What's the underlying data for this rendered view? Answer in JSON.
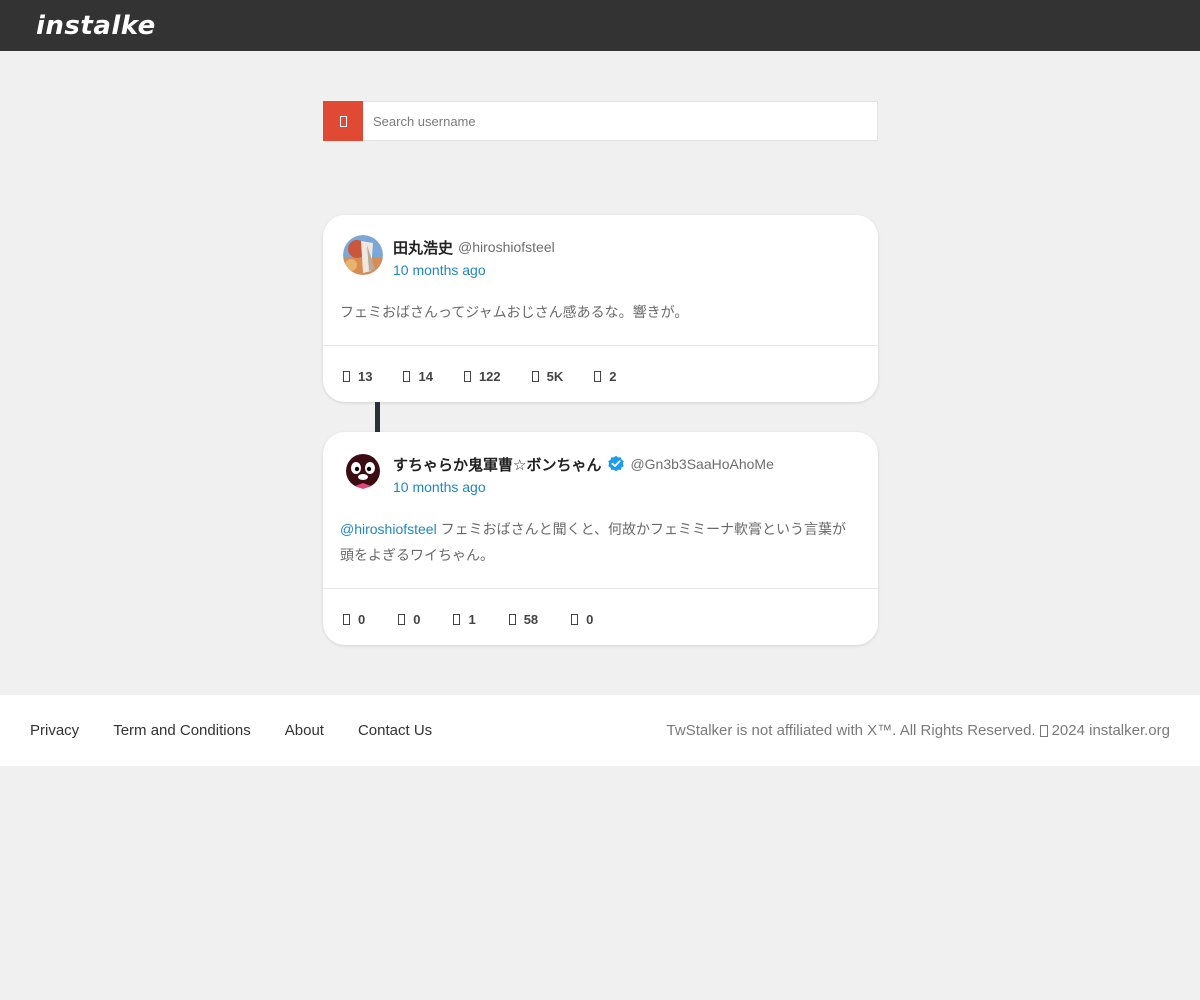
{
  "header": {
    "logo_text": "instalker",
    "logo_color": "#f2704e"
  },
  "search": {
    "placeholder": "Search username",
    "button_color": "#e04a35",
    "button_icon": "search-icon"
  },
  "tweets": [
    {
      "display_name": "田丸浩史",
      "handle": "@hiroshiofsteel",
      "time": "10 months ago",
      "verified": false,
      "mention": "",
      "text": "フェミおばさんってジャムおじさん感あるな。響きが。",
      "stats": {
        "replies": "13",
        "retweets": "14",
        "likes": "122",
        "views": "5K",
        "bookmarks": "2"
      }
    },
    {
      "display_name": "すちゃらか鬼軍曹☆ボンちゃん",
      "handle": "@Gn3b3SaaHoAhoMe",
      "time": "10 months ago",
      "verified": true,
      "mention": "@hiroshiofsteel",
      "text": " フェミおばさんと聞くと、何故かフェミミーナ軟膏という言葉が頭をよぎるワイちゃん。",
      "stats": {
        "replies": "0",
        "retweets": "0",
        "likes": "1",
        "views": "58",
        "bookmarks": "0"
      }
    }
  ],
  "footer": {
    "links": [
      "Privacy",
      "Term and Conditions",
      "About",
      "Contact Us"
    ],
    "copyright_prefix": "TwStalker is not affiliated with X™. All Rights Reserved.",
    "copyright_suffix": "2024 instalker.org"
  },
  "colors": {
    "accent_link": "#1f86c7",
    "verified_badge": "#1d9bf0",
    "header_bg": "#333333",
    "page_bg": "#f0f0f0"
  }
}
